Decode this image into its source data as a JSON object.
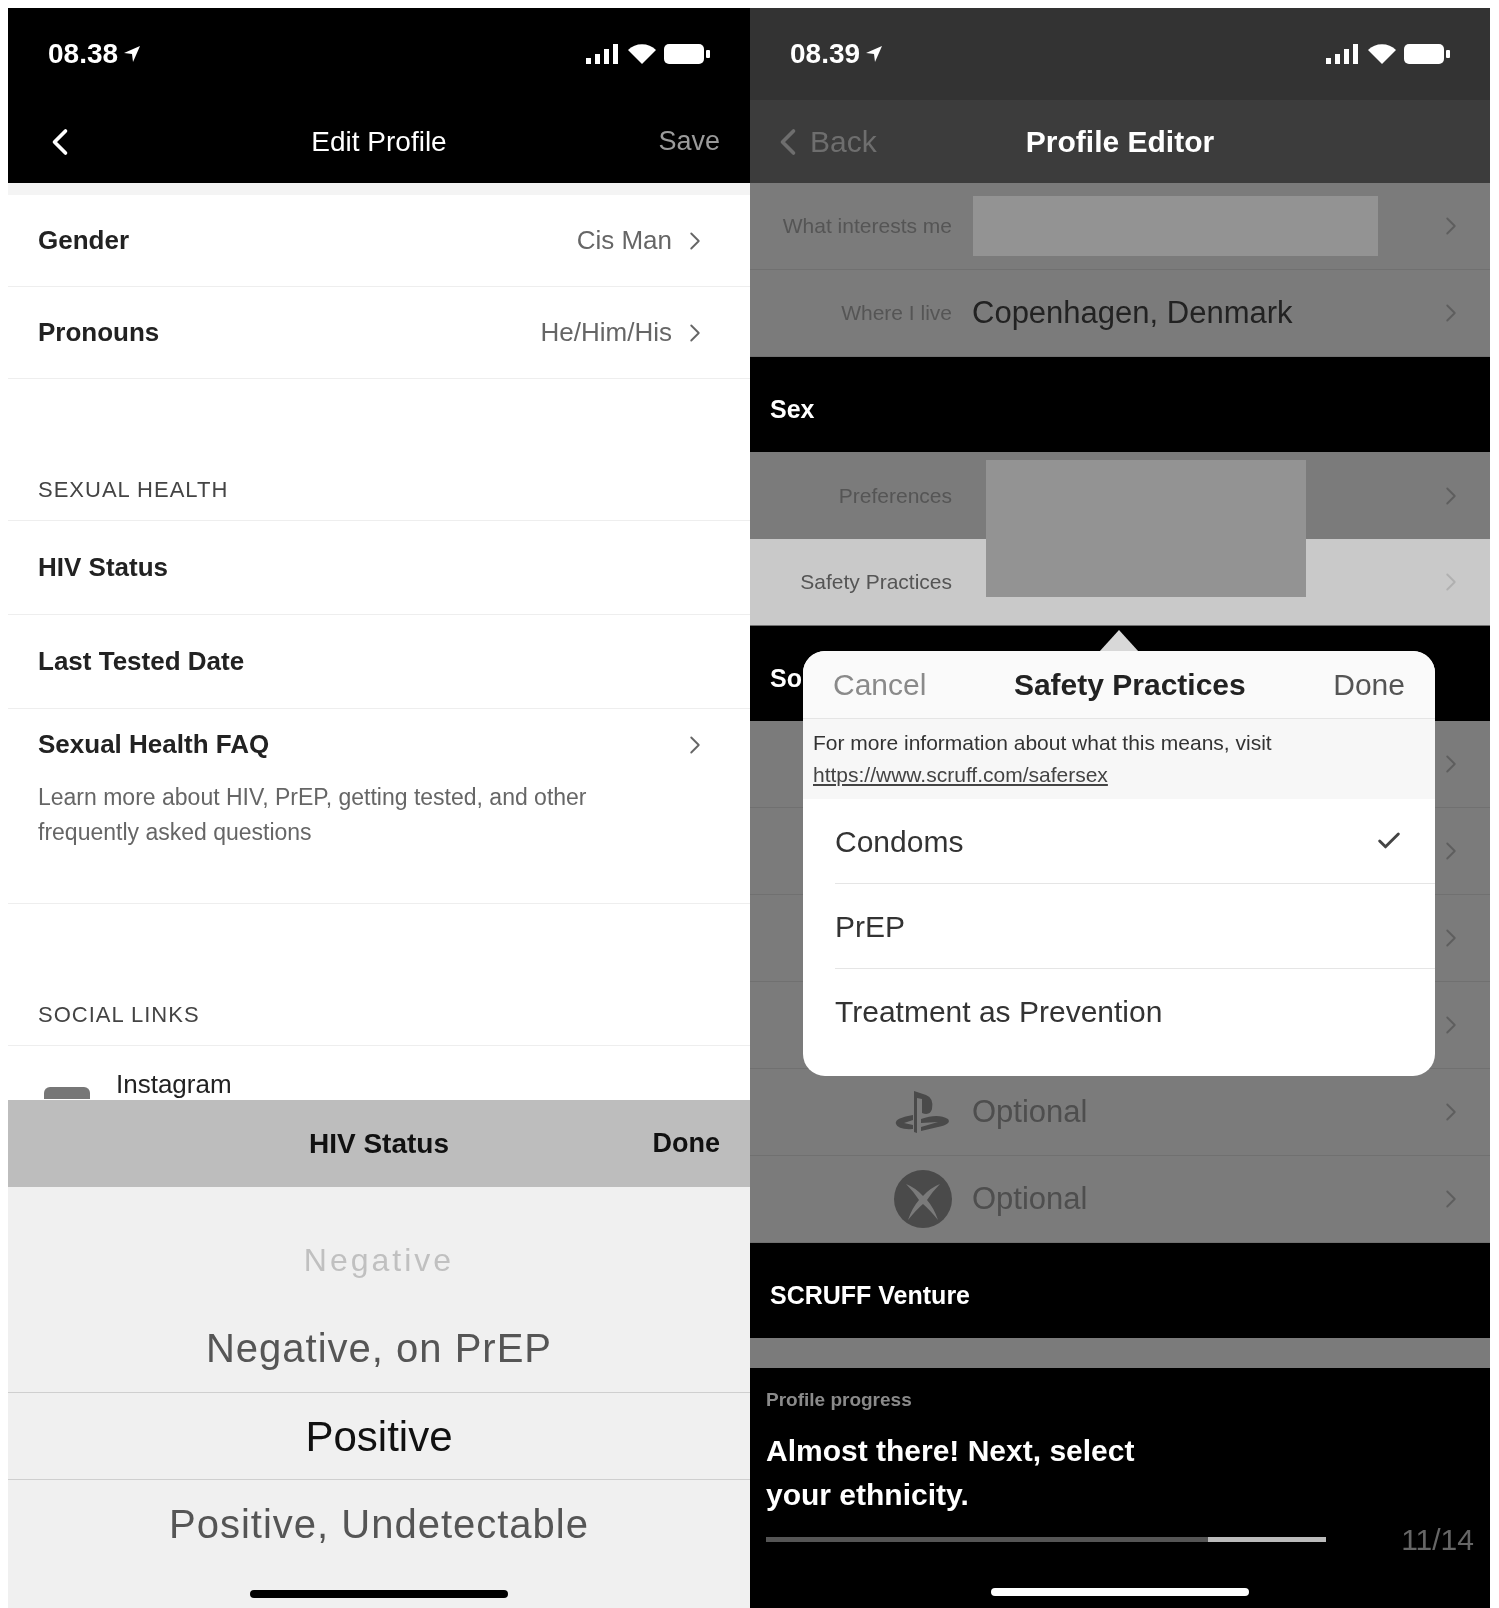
{
  "left_screen": {
    "status_bar": {
      "time": "08.38"
    },
    "nav": {
      "title": "Edit Profile",
      "action": "Save"
    },
    "rows": [
      {
        "label": "Gender",
        "value": "Cis Man"
      },
      {
        "label": "Pronouns",
        "value": "He/Him/His"
      }
    ],
    "sections": [
      {
        "header": "SEXUAL HEALTH",
        "items": [
          {
            "kind": "plain",
            "label": "HIV Status"
          },
          {
            "kind": "plain",
            "label": "Last Tested Date"
          },
          {
            "kind": "link",
            "label": "Sexual Health FAQ",
            "description": "Learn more about HIV, PrEP, getting tested, and other frequently asked questions"
          }
        ]
      },
      {
        "header": "SOCIAL LINKS",
        "items": [
          {
            "kind": "social",
            "label": "Instagram"
          }
        ]
      }
    ],
    "picker": {
      "title": "HIV Status",
      "done": "Done",
      "options": [
        {
          "label": "Negative",
          "selected": false
        },
        {
          "label": "Negative, on PrEP",
          "selected": false
        },
        {
          "label": "Positive",
          "selected": true
        },
        {
          "label": "Positive, Undetectable",
          "selected": false
        }
      ]
    }
  },
  "right_screen": {
    "status_bar": {
      "time": "08.39"
    },
    "nav": {
      "back": "Back",
      "title": "Profile Editor"
    },
    "items": [
      {
        "kind": "row",
        "label": "What interests me",
        "redacted": true,
        "selected": false
      },
      {
        "kind": "row",
        "label": "Where I live",
        "value": "Copenhagen, Denmark",
        "selected": false
      },
      {
        "kind": "header",
        "label": "Sex"
      },
      {
        "kind": "row",
        "label": "Preferences",
        "redacted": true,
        "selected": false
      },
      {
        "kind": "row",
        "label": "Safety Practices",
        "redacted": true,
        "selected": true
      },
      {
        "kind": "header",
        "label": "So"
      },
      {
        "kind": "row",
        "selected": false
      },
      {
        "kind": "row",
        "selected": false
      },
      {
        "kind": "row",
        "selected": false
      },
      {
        "kind": "row",
        "selected": false
      },
      {
        "kind": "logorow",
        "value": "Optional",
        "selected": false
      },
      {
        "kind": "logorow",
        "value": "Optional",
        "selected": false
      },
      {
        "kind": "header",
        "label": "SCRUFF Venture"
      }
    ],
    "popup": {
      "cancel": "Cancel",
      "title": "Safety Practices",
      "done": "Done",
      "info": "For more information about what this means, visit",
      "link": "https://www.scruff.com/safersex",
      "options": [
        {
          "label": "Condoms",
          "checked": true
        },
        {
          "label": "PrEP",
          "checked": false
        },
        {
          "label": "Treatment as Prevention",
          "checked": false
        }
      ]
    },
    "progress": {
      "label": "Profile progress",
      "message": "Almost there! Next, select your ethnicity.",
      "level": 0.79,
      "count": "11/14"
    }
  }
}
